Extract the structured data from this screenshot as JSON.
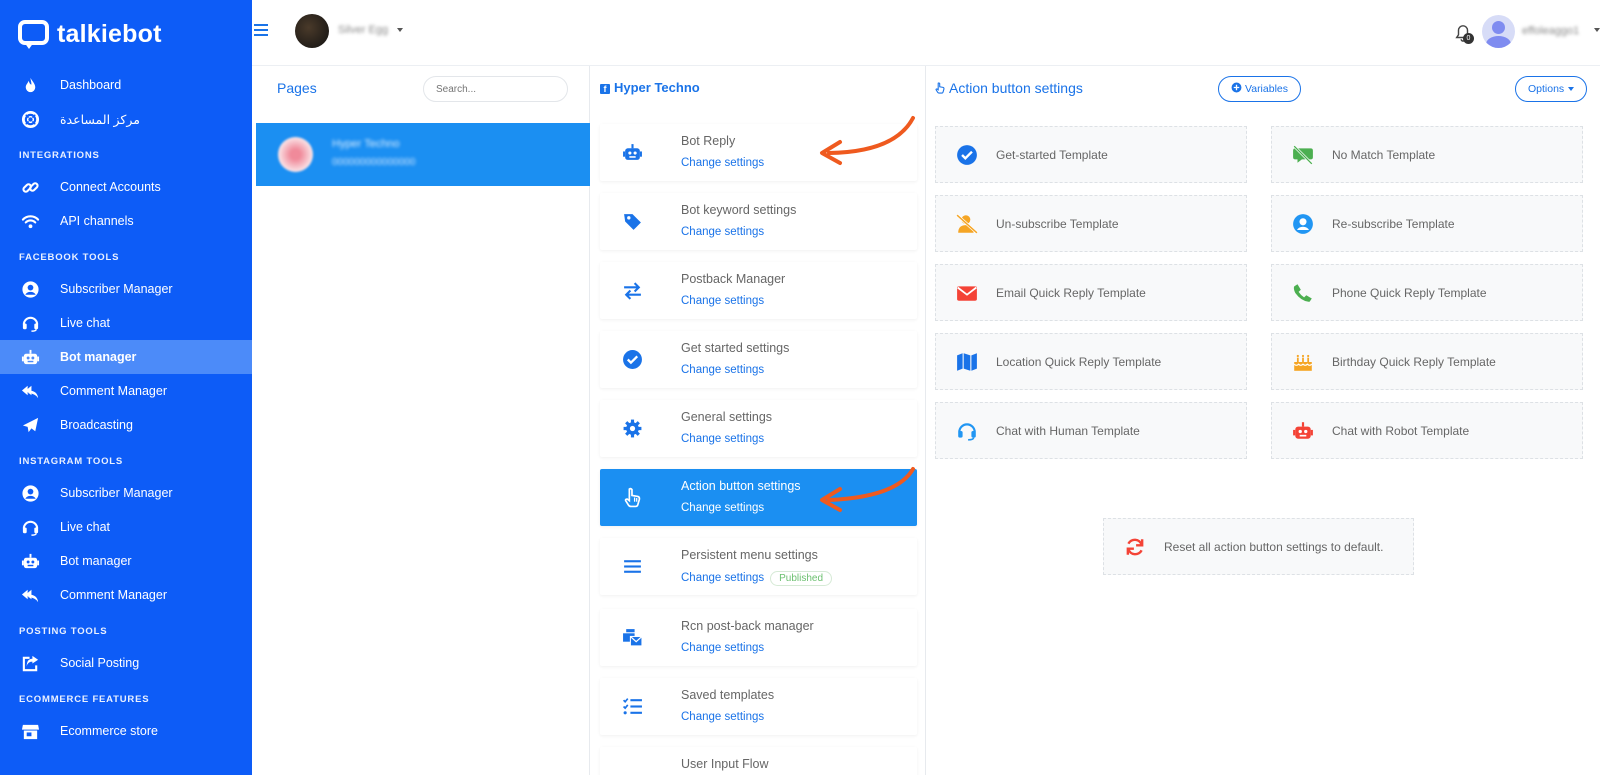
{
  "brand": {
    "name": "talkiebot"
  },
  "sidebar": {
    "top_items": [
      {
        "label": "Dashboard",
        "icon": "flame-icon"
      },
      {
        "label": "مركز المساعدة",
        "icon": "lifebuoy-icon"
      }
    ],
    "sections": [
      {
        "title": "INTEGRATIONS",
        "items": [
          {
            "label": "Connect Accounts",
            "icon": "link-icon"
          },
          {
            "label": "API channels",
            "icon": "wifi-icon"
          }
        ]
      },
      {
        "title": "FACEBOOK TOOLS",
        "items": [
          {
            "label": "Subscriber Manager",
            "icon": "user-circle-icon"
          },
          {
            "label": "Live chat",
            "icon": "headset-icon"
          },
          {
            "label": "Bot manager",
            "icon": "robot-icon",
            "active": true
          },
          {
            "label": "Comment Manager",
            "icon": "reply-all-icon"
          },
          {
            "label": "Broadcasting",
            "icon": "paper-plane-icon"
          }
        ]
      },
      {
        "title": "INSTAGRAM TOOLS",
        "items": [
          {
            "label": "Subscriber Manager",
            "icon": "user-circle-icon"
          },
          {
            "label": "Live chat",
            "icon": "headset-icon"
          },
          {
            "label": "Bot manager",
            "icon": "robot-icon"
          },
          {
            "label": "Comment Manager",
            "icon": "reply-all-icon"
          }
        ]
      },
      {
        "title": "POSTING TOOLS",
        "items": [
          {
            "label": "Social Posting",
            "icon": "share-square-icon"
          }
        ]
      },
      {
        "title": "ECOMMERCE FEATURES",
        "items": [
          {
            "label": "Ecommerce store",
            "icon": "store-icon"
          }
        ]
      }
    ]
  },
  "topbar": {
    "page_name": "Silver Egg",
    "notification_count": "0",
    "user_name": "effoleaggo1"
  },
  "pages": {
    "title": "Pages",
    "search_placeholder": "Search...",
    "items": [
      {
        "name": "Hyper Techno",
        "id": "000000000000000"
      }
    ]
  },
  "settings": {
    "page_title": "Hyper Techno",
    "link_label": "Change settings",
    "published_label": "Published",
    "items": [
      {
        "name": "Bot Reply",
        "icon": "robot-icon"
      },
      {
        "name": "Bot keyword settings",
        "icon": "tag-icon"
      },
      {
        "name": "Postback Manager",
        "icon": "exchange-icon"
      },
      {
        "name": "Get started settings",
        "icon": "check-circle-icon"
      },
      {
        "name": "General settings",
        "icon": "gear-icon"
      },
      {
        "name": "Action button settings",
        "icon": "hand-pointer-icon",
        "active": true
      },
      {
        "name": "Persistent menu settings",
        "icon": "bars-icon",
        "published": true
      },
      {
        "name": "Rcn post-back manager",
        "icon": "mail-bulk-icon"
      },
      {
        "name": "Saved templates",
        "icon": "list-check-icon"
      },
      {
        "name": "User Input Flow",
        "icon": "flow-icon"
      }
    ]
  },
  "action": {
    "title": "Action button settings",
    "variables_label": "Variables",
    "options_label": "Options",
    "templates": [
      {
        "name": "Get-started Template",
        "icon": "check-circle-icon",
        "color": "#1a73e8"
      },
      {
        "name": "No Match Template",
        "icon": "comment-slash-icon",
        "color": "#4caf50"
      },
      {
        "name": "Un-subscribe Template",
        "icon": "user-slash-icon",
        "color": "#f5a524"
      },
      {
        "name": "Re-subscribe Template",
        "icon": "user-circle-icon",
        "color": "#2196f3"
      },
      {
        "name": "Email Quick Reply Template",
        "icon": "envelope-icon",
        "color": "#f44336"
      },
      {
        "name": "Phone Quick Reply Template",
        "icon": "phone-icon",
        "color": "#4caf50"
      },
      {
        "name": "Location Quick Reply Template",
        "icon": "map-icon",
        "color": "#1a73e8"
      },
      {
        "name": "Birthday Quick Reply Template",
        "icon": "birthday-cake-icon",
        "color": "#f5a524"
      },
      {
        "name": "Chat with Human Template",
        "icon": "headset-icon",
        "color": "#2196f3"
      },
      {
        "name": "Chat with Robot Template",
        "icon": "robot-icon",
        "color": "#f44336"
      }
    ],
    "reset_label": "Reset all action button settings to default."
  },
  "colors": {
    "sidebar": "#0d5cf7",
    "sidebar_active": "#4c8bf9",
    "accent": "#1a73e8",
    "selected": "#1b8ff2",
    "arrow": "#ef5a1f"
  }
}
